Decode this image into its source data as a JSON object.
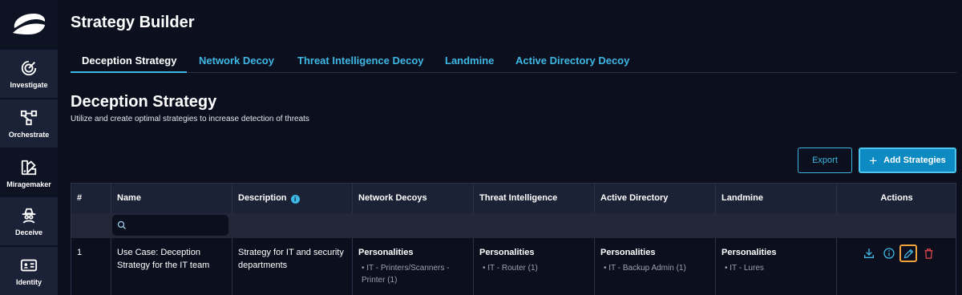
{
  "sidebar": {
    "items": [
      {
        "label": "Investigate",
        "icon": "target-icon"
      },
      {
        "label": "Orchestrate",
        "icon": "workflow-icon"
      },
      {
        "label": "Miragemaker",
        "icon": "palette-icon"
      },
      {
        "label": "Deceive",
        "icon": "spy-icon"
      },
      {
        "label": "Identity",
        "icon": "id-card-icon"
      }
    ]
  },
  "header": {
    "title": "Strategy Builder"
  },
  "tabs": [
    {
      "label": "Deception Strategy",
      "active": true
    },
    {
      "label": "Network Decoy"
    },
    {
      "label": "Threat Intelligence Decoy"
    },
    {
      "label": "Landmine"
    },
    {
      "label": "Active Directory Decoy"
    }
  ],
  "section": {
    "title": "Deception Strategy",
    "subtitle": "Utilize and create optimal strategies to increase detection of threats"
  },
  "toolbar": {
    "export_label": "Export",
    "add_label": "Add Strategies"
  },
  "table": {
    "headers": [
      "#",
      "Name",
      "Description",
      "Network Decoys",
      "Threat Intelligence",
      "Active Directory",
      "Landmine",
      "Actions"
    ],
    "search_placeholder": "",
    "rows": [
      {
        "num": "1",
        "name": "Use Case: Deception Strategy for the IT team",
        "description": "Strategy for IT and security departments",
        "network_decoys": {
          "heading": "Personalities",
          "items": [
            "IT - Printers/Scanners - Printer (1)"
          ]
        },
        "threat_intelligence": {
          "heading": "Personalities",
          "items": [
            "IT - Router (1)"
          ]
        },
        "active_directory": {
          "heading": "Personalities",
          "items": [
            "IT - Backup Admin (1)"
          ]
        },
        "landmine": {
          "heading": "Personalities",
          "items": [
            "IT - Lures"
          ]
        }
      }
    ]
  },
  "colors": {
    "accent": "#3fb7e4",
    "background": "#0b0f1e",
    "highlight": "#f0a33a",
    "danger": "#e5484d"
  }
}
